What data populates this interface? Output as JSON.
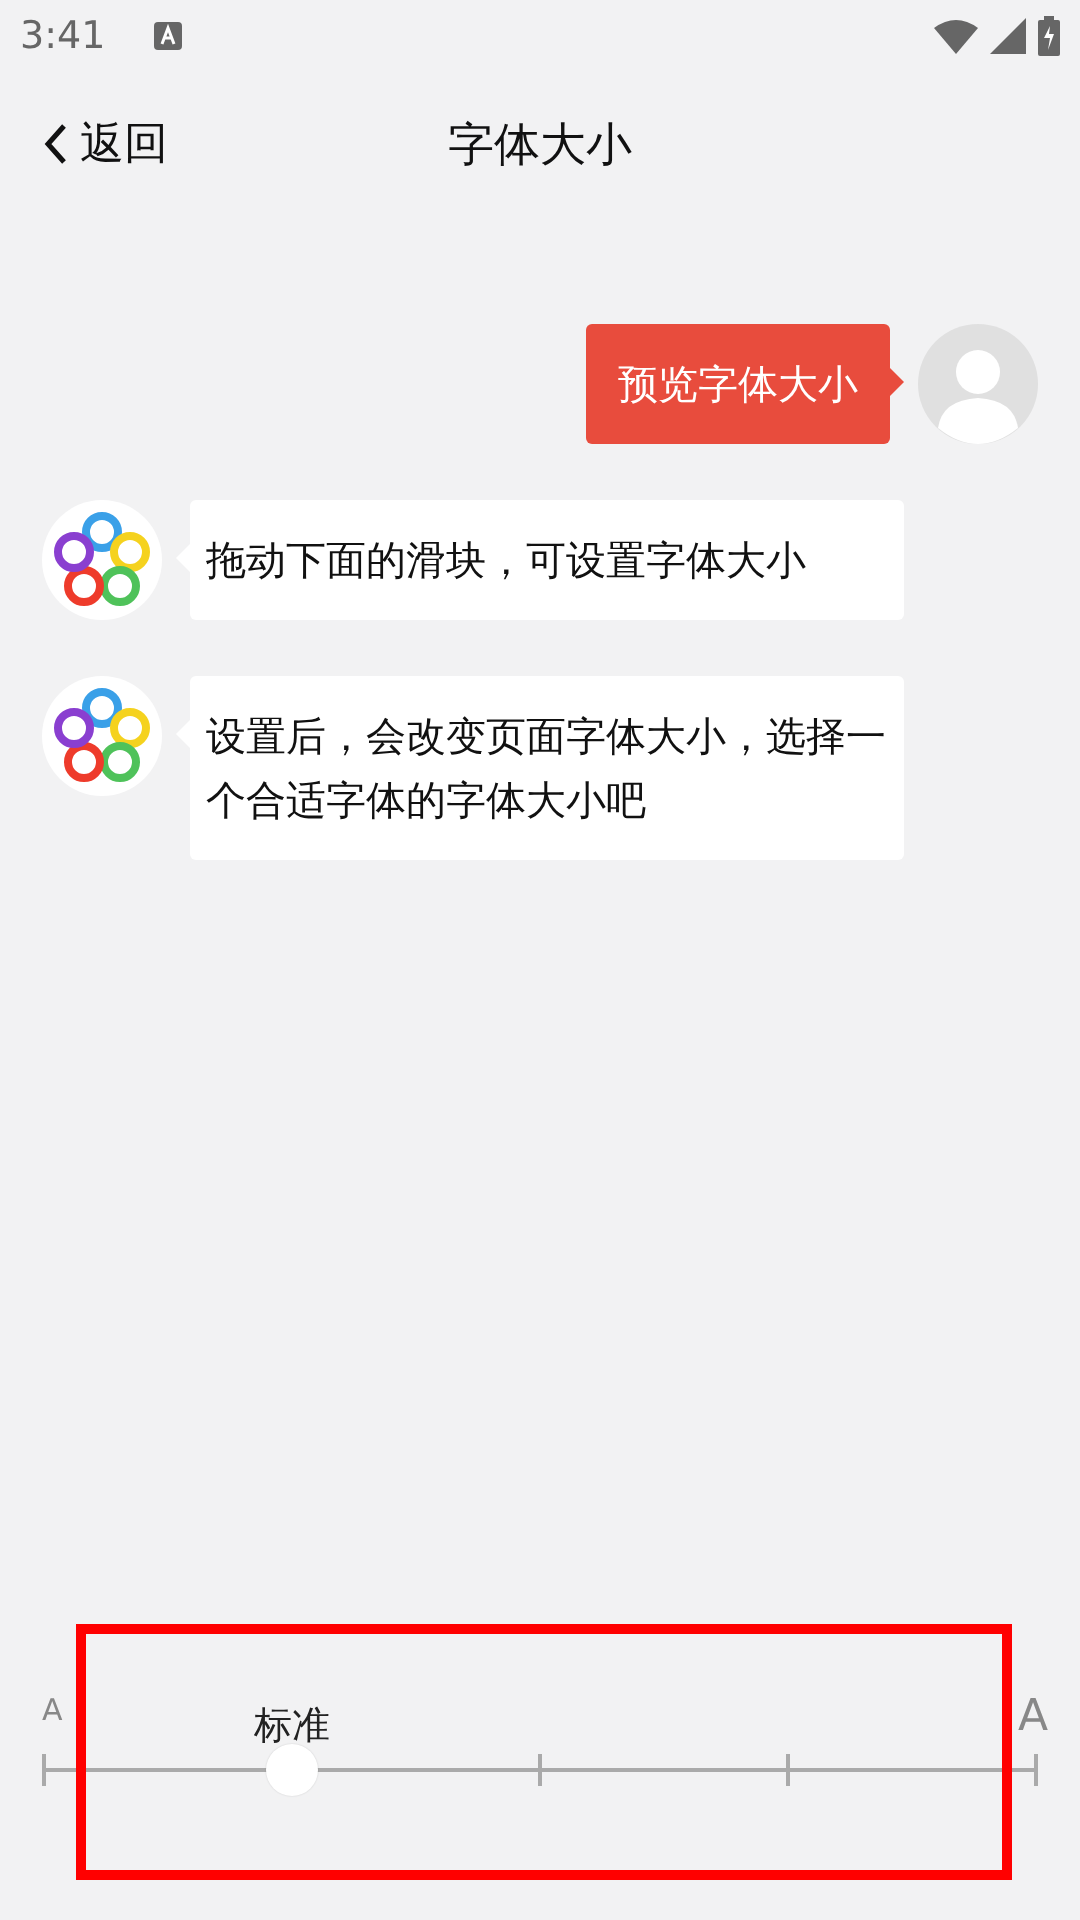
{
  "status_bar": {
    "time": "3:41"
  },
  "header": {
    "back_label": "返回",
    "title": "字体大小"
  },
  "messages": [
    {
      "kind": "sent",
      "text": "预览字体大小"
    },
    {
      "kind": "received",
      "text": "拖动下面的滑块，可设置字体大小"
    },
    {
      "kind": "received",
      "text": "设置后，会改变页面字体大小，选择一个合适字体的字体大小吧"
    }
  ],
  "font_slider": {
    "min_label": "A",
    "max_label": "A",
    "value_label": "标准",
    "level": 0.25
  }
}
